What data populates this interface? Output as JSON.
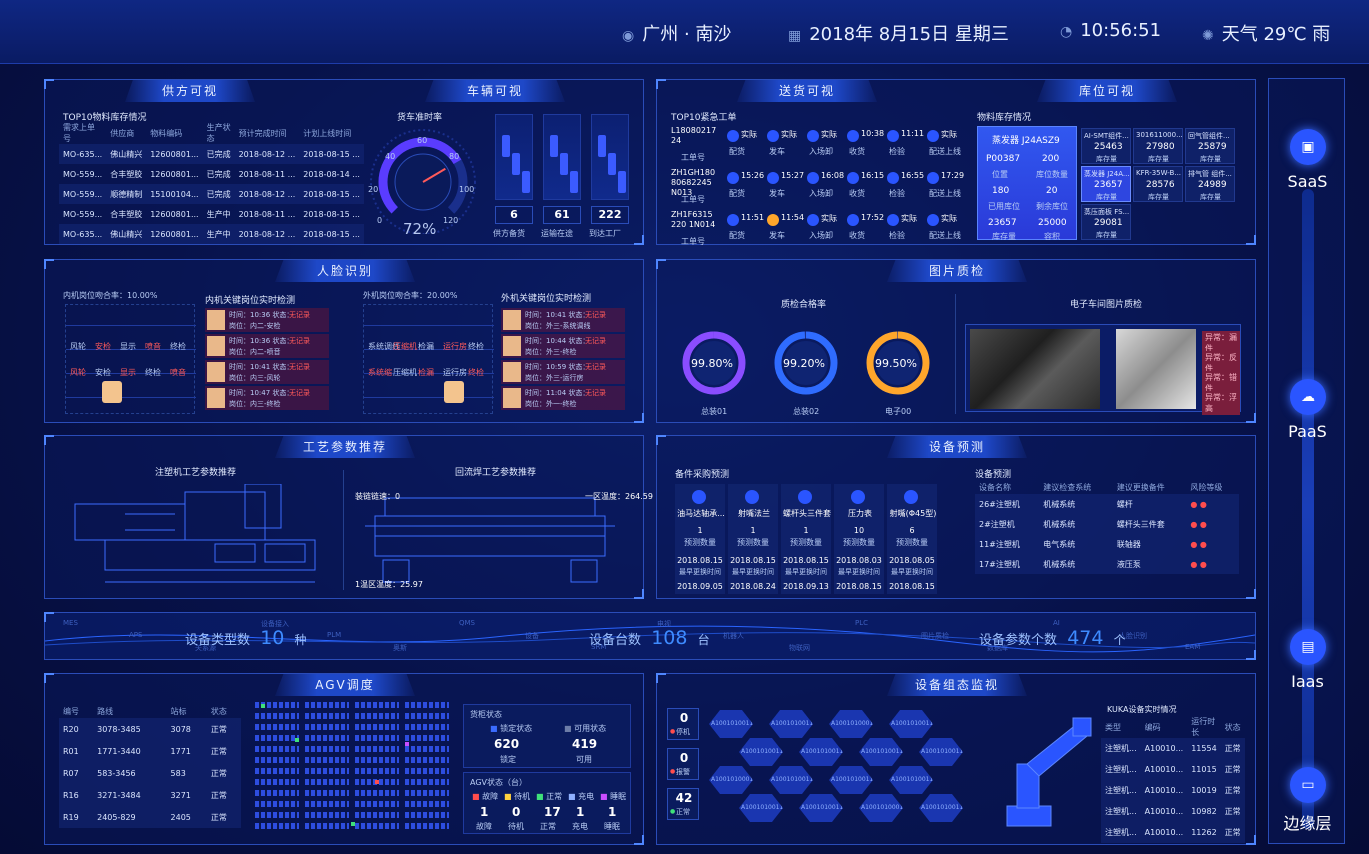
{
  "header": {
    "location": "广州 · 南沙",
    "date": "2018年  8月15日  星期三",
    "time": "10:56:51",
    "weather": "天气   29℃     雨"
  },
  "supply": {
    "title": "供方可视",
    "subtitle": "TOP10物料库存情况",
    "columns": [
      "需求上单号",
      "供应商",
      "物料编码",
      "生产状态",
      "预计完成时间",
      "计划上线时间"
    ],
    "rows": [
      [
        "MO-635...",
        "佛山精兴",
        "12600801...",
        "已完成",
        "2018-08-12 ...",
        "2018-08-15 ..."
      ],
      [
        "MO-559...",
        "合丰塑胶",
        "12600801...",
        "已完成",
        "2018-08-11 ...",
        "2018-08-14 ..."
      ],
      [
        "MO-559...",
        "顺德精制",
        "15100104...",
        "已完成",
        "2018-08-12 ...",
        "2018-08-15 ..."
      ],
      [
        "MO-559...",
        "合丰塑胶",
        "12600801...",
        "生产中",
        "2018-08-11 ...",
        "2018-08-15 ..."
      ],
      [
        "MO-635...",
        "佛山精兴",
        "12600801...",
        "生产中",
        "2018-08-12 ...",
        "2018-08-15 ..."
      ]
    ]
  },
  "vehicle": {
    "title": "车辆可视",
    "gauge_title": "货车准时率",
    "gauge_value": "72%",
    "gauge_fraction": 0.72,
    "ticks": [
      "0",
      "20",
      "40",
      "60",
      "80",
      "100",
      "120"
    ],
    "counters": [
      {
        "value": "6",
        "label": "供方备货"
      },
      {
        "value": "61",
        "label": "运输在途"
      },
      {
        "value": "222",
        "label": "到达工厂"
      }
    ]
  },
  "delivery": {
    "title": "送货可视",
    "subtitle": "TOP10紧急工单",
    "orders": [
      {
        "id": "L1808021724",
        "label": "工单号"
      },
      {
        "id": "ZH1GH18080682245N013",
        "label": "工单号"
      },
      {
        "id": "ZH1F6315220 1N014",
        "label": "工单号"
      }
    ],
    "steps": [
      "配货",
      "发车",
      "入场卸",
      "收货",
      "检验",
      "配送上线"
    ],
    "times": [
      [
        "实际",
        "实际",
        "实际",
        "10:38",
        "11:11",
        "实际"
      ],
      [
        "15:26",
        "15:27",
        "16:08",
        "16:15",
        "16:55",
        "17:29"
      ],
      [
        "11:51",
        "11:54",
        "实际",
        "17:52",
        "实际",
        "实际"
      ]
    ]
  },
  "warehouse": {
    "title": "库位可视",
    "subtitle": "物料库存情况",
    "main": {
      "name": "蒸发器 J24ASZ9",
      "a": "P00387",
      "a_label": "位置",
      "b": "200",
      "b_label": "库位数量",
      "c": "180",
      "c_label": "已用库位",
      "d": "20",
      "d_label": "剩余库位",
      "e": "23657",
      "e_label": "库存量",
      "f": "25000",
      "f_label": "容积"
    },
    "cells": [
      {
        "name": "AI-SMT组件...",
        "value": "25463",
        "label": "库存量"
      },
      {
        "name": "301611000...",
        "value": "27980",
        "label": "库存量"
      },
      {
        "name": "回气管组件...",
        "value": "25879",
        "label": "库存量"
      },
      {
        "name": "蒸发器 J24A...",
        "value": "23657",
        "label": "库存量"
      },
      {
        "name": "KFR-35W-B...",
        "value": "28576",
        "label": "库存量"
      },
      {
        "name": "排气管 组件...",
        "value": "24989",
        "label": "库存量"
      },
      {
        "name": "蒸压面板 FS...",
        "value": "29081",
        "label": "库存量"
      }
    ]
  },
  "face": {
    "title": "人脸识别",
    "left_rate": "内机岗位吻合率：10.00%",
    "right_rate": "外机岗位吻合率：20.00%",
    "left_title": "内机关键岗位实时检测",
    "right_title": "外机关键岗位实时检测",
    "left_list": [
      [
        "时间：10:36 状态：",
        "无记录",
        "岗位：内二-安检"
      ],
      [
        "时间：10:36 状态：",
        "无记录",
        "岗位：内二-喷音"
      ],
      [
        "时间：10:41 状态：",
        "无记录",
        "岗位：内三-风轮"
      ],
      [
        "时间：10:47 状态：",
        "无记录",
        "岗位：内三-终检"
      ]
    ],
    "right_list": [
      [
        "时间：10:41 状态：",
        "无记录",
        "岗位：外三-系统调线"
      ],
      [
        "时间：10:44 状态：",
        "无记录",
        "岗位：外三-终检"
      ],
      [
        "时间：10:59 状态：",
        "无记录",
        "岗位：外三-运行房"
      ],
      [
        "时间：11:04 状态：",
        "无记录",
        "岗位：外一-终检"
      ]
    ],
    "left_map": [
      "风轮",
      "安检",
      "显示",
      "喷音",
      "终检",
      "风轮",
      "安检",
      "显示",
      "终检",
      "喷音"
    ],
    "right_map": [
      "系统调线",
      "压缩机",
      "检漏",
      "运行房",
      "终检",
      "系统缩",
      "压缩机",
      "检漏",
      "运行房",
      "终检"
    ]
  },
  "image_quality": {
    "title": "图片质检",
    "rate_title": "质检合格率",
    "gauges": [
      {
        "value": "99.80%",
        "label": "总装01",
        "fraction": 0.998,
        "color": "#8a4dff"
      },
      {
        "value": "99.20%",
        "label": "总装02",
        "fraction": 0.992,
        "color": "#2f6cff"
      },
      {
        "value": "99.50%",
        "label": "电子00",
        "fraction": 0.995,
        "color": "#ffa62b"
      }
    ],
    "photo_title": "电子车间图片质检",
    "flags": [
      "异常：漏件",
      "异常：反件",
      "异常：错件",
      "异常：浮高"
    ]
  },
  "process": {
    "title": "工艺参数推荐",
    "left_title": "注塑机工艺参数推荐",
    "right_title": "回流焊工艺参数推荐",
    "labels": [
      "装链链速：0",
      "一区温度：264.59",
      "1温区温度：25.97"
    ]
  },
  "equip_pred": {
    "title": "设备预测",
    "left_title": "备件采购预测",
    "right_title": "设备预测",
    "parts": [
      {
        "name": "油马达轴承...",
        "count": "1",
        "count_label": "预测数量",
        "d1": "2018.08.15",
        "d1_label": "最早更换时间",
        "d2": "2018.09.05"
      },
      {
        "name": "射嘴法兰",
        "count": "1",
        "count_label": "预测数量",
        "d1": "2018.08.15",
        "d1_label": "最早更换时间",
        "d2": "2018.08.24"
      },
      {
        "name": "螺杆头三件套",
        "count": "1",
        "count_label": "预测数量",
        "d1": "2018.08.15",
        "d1_label": "最早更换时间",
        "d2": "2018.09.13"
      },
      {
        "name": "压力表",
        "count": "10",
        "count_label": "预测数量",
        "d1": "2018.08.03",
        "d1_label": "最早更换时间",
        "d2": "2018.08.15"
      },
      {
        "name": "射嘴(Φ45型)",
        "count": "6",
        "count_label": "预测数量",
        "d1": "2018.08.05",
        "d1_label": "最早更换时间",
        "d2": "2018.08.15"
      }
    ],
    "columns": [
      "设备名称",
      "建议检查系统",
      "建议更换备件",
      "风险等级"
    ],
    "rows": [
      [
        "26#注塑机",
        "机械系统",
        "螺杆"
      ],
      [
        "2#注塑机",
        "机械系统",
        "螺杆头三件套"
      ],
      [
        "11#注塑机",
        "电气系统",
        "联轴器"
      ],
      [
        "17#注塑机",
        "机械系统",
        "液压泵"
      ]
    ]
  },
  "stats": {
    "type_label": "设备类型数",
    "type_value": "10",
    "type_unit": "种",
    "count_label": "设备台数",
    "count_value": "108",
    "count_unit": "台",
    "param_label": "设备参数个数",
    "param_value": "474",
    "param_unit": "个",
    "bg": [
      "MES",
      "APS",
      "关系源",
      "设备接入",
      "PLM",
      "奥斯",
      "QMS",
      "设备",
      "SRM",
      "电视",
      "机器人",
      "物联网",
      "PLC",
      "图片质检",
      "数据库",
      "AI",
      "人脸识别",
      "EAM"
    ]
  },
  "agv": {
    "title": "AGV调度",
    "columns": [
      "编号",
      "路线",
      "站标",
      "状态"
    ],
    "rows": [
      [
        "R20",
        "3078-3485",
        "3078",
        "正常"
      ],
      [
        "R01",
        "1771-3440",
        "1771",
        "正常"
      ],
      [
        "R07",
        "583-3456",
        "583",
        "正常"
      ],
      [
        "R16",
        "3271-3484",
        "3271",
        "正常"
      ],
      [
        "R19",
        "2405-829",
        "2405",
        "正常"
      ]
    ],
    "shelf_title": "货柜状态",
    "locked_label": "锁定状态",
    "usable_label": "可用状态",
    "locked": "620",
    "locked_sub": "锁定",
    "usable": "419",
    "usable_sub": "可用",
    "status_title": "AGV状态（台）",
    "status": [
      {
        "label": "故障",
        "value": "1",
        "color": "#ff4d4d"
      },
      {
        "label": "待机",
        "value": "0",
        "color": "#ffd23f"
      },
      {
        "label": "正常",
        "value": "17",
        "color": "#3fe07a"
      },
      {
        "label": "充电",
        "value": "1",
        "color": "#8fb0ff"
      },
      {
        "label": "睡眠",
        "value": "1",
        "color": "#c94dff"
      }
    ]
  },
  "equip_monitor": {
    "title": "设备组态监视",
    "counts": [
      {
        "value": "0",
        "label": "停机"
      },
      {
        "value": "0",
        "label": "报警"
      },
      {
        "value": "42",
        "label": "正常"
      }
    ],
    "hex_labels": [
      "A100101001170010",
      "A100101001140114",
      "A1001010001140108",
      "A100101001140128",
      "A10010100114072",
      "A100101001151490"
    ],
    "table_title": "KUKA设备实时情况",
    "columns": [
      "类型",
      "编码",
      "运行时长",
      "状态"
    ],
    "rows": [
      [
        "注塑机...",
        "A10010...",
        "11554",
        "正常"
      ],
      [
        "注塑机...",
        "A10010...",
        "11015",
        "正常"
      ],
      [
        "注塑机...",
        "A10010...",
        "10019",
        "正常"
      ],
      [
        "注塑机...",
        "A10010...",
        "10982",
        "正常"
      ],
      [
        "注塑机...",
        "A10010...",
        "11262",
        "正常"
      ]
    ]
  },
  "sidebar": {
    "items": [
      {
        "label": "SaaS",
        "icon": "cloud-box-icon"
      },
      {
        "label": "PaaS",
        "icon": "cloud-upload-icon"
      },
      {
        "label": "Iaas",
        "icon": "server-icon"
      },
      {
        "label": "边缘层",
        "icon": "message-icon"
      }
    ]
  }
}
